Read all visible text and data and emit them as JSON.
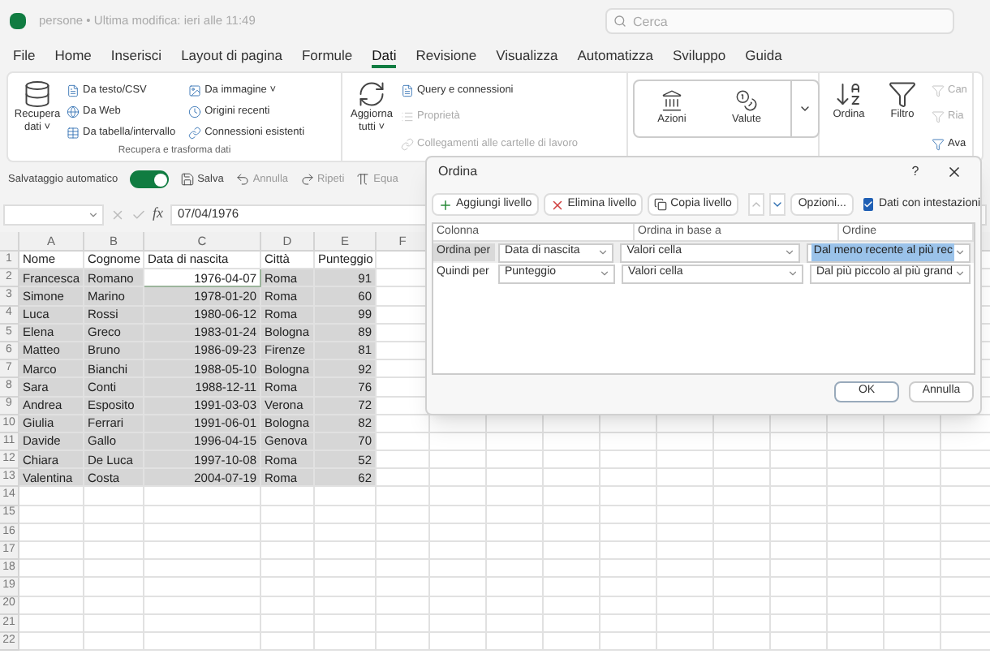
{
  "title_bar": {
    "file_title": "persone • Ultima modifica: ieri alle 11:49",
    "search": {
      "placeholder": "Cerca"
    }
  },
  "menu_tabs": [
    {
      "label": "File",
      "selected": false
    },
    {
      "label": "Home",
      "selected": false
    },
    {
      "label": "Inserisci",
      "selected": false
    },
    {
      "label": "Layout di pagina",
      "selected": false
    },
    {
      "label": "Formule",
      "selected": false
    },
    {
      "label": "Dati",
      "selected": true
    },
    {
      "label": "Revisione",
      "selected": false
    },
    {
      "label": "Visualizza",
      "selected": false
    },
    {
      "label": "Automatizza",
      "selected": false
    },
    {
      "label": "Sviluppo",
      "selected": false
    },
    {
      "label": "Guida",
      "selected": false
    }
  ],
  "ribbon": {
    "groups": [
      {
        "label": "Recupera e trasforma dati",
        "big": [
          {
            "label": "Recupera dati ˅"
          }
        ],
        "small": [
          {
            "label": "Da testo/CSV",
            "disabled": false
          },
          {
            "label": "Da Web",
            "disabled": false
          },
          {
            "label": "Da tabella/intervallo",
            "disabled": false
          },
          {
            "label": "Da immagine ˅",
            "disabled": false
          },
          {
            "label": "Origini recenti",
            "disabled": false
          },
          {
            "label": "Connessioni esistenti",
            "disabled": false
          }
        ]
      },
      {
        "big": [
          {
            "label": "Aggiorna tutti ˅"
          }
        ],
        "small": [
          {
            "label": "Query e connessioni",
            "disabled": false
          },
          {
            "label": "Proprietà",
            "disabled": true
          },
          {
            "label": "Collegamenti alle cartelle di lavoro",
            "disabled": true
          }
        ]
      },
      {
        "gallery": [
          {
            "label": "Azioni"
          },
          {
            "label": "Valute"
          }
        ]
      },
      {
        "big": [
          {
            "label": "Ordina"
          },
          {
            "label": "Filtro"
          }
        ],
        "small": [
          {
            "label": "Can",
            "disabled": true
          },
          {
            "label": "Ria",
            "disabled": true
          },
          {
            "label": "Ava",
            "disabled": false
          }
        ]
      }
    ]
  },
  "quick_access": {
    "autosave_label": "Salvataggio automatico",
    "autosave_on": true,
    "items": [
      {
        "label": "Salva"
      },
      {
        "label": "Annulla"
      },
      {
        "label": "Ripeti"
      },
      {
        "label": "Equa"
      }
    ]
  },
  "formula_bar": {
    "function_label": "fx",
    "formula": "07/04/1976"
  },
  "sheet": {
    "columns": [
      "A",
      "B",
      "C",
      "D",
      "E",
      "F"
    ],
    "rows": [
      {
        "number": "1",
        "kind": "header",
        "selected": false,
        "cells": [
          {
            "text": "Nome",
            "active": false
          },
          {
            "text": "Cognome",
            "active": false
          },
          {
            "text": "Data di nascita",
            "active": false
          },
          {
            "text": "Città",
            "active": false
          },
          {
            "text": "Punteggio",
            "active": false
          }
        ]
      },
      {
        "number": "2",
        "kind": "data",
        "selected": true,
        "cells": [
          {
            "text": "Francesca",
            "active": false
          },
          {
            "text": "Romano",
            "active": false
          },
          {
            "text": "1976-04-07",
            "active": true
          },
          {
            "text": "Roma",
            "active": false
          },
          {
            "text": "91",
            "active": false
          }
        ]
      },
      {
        "number": "3",
        "kind": "data",
        "selected": true,
        "cells": [
          {
            "text": "Simone",
            "active": false
          },
          {
            "text": "Marino",
            "active": false
          },
          {
            "text": "1978-01-20",
            "active": false
          },
          {
            "text": "Roma",
            "active": false
          },
          {
            "text": "60",
            "active": false
          }
        ]
      },
      {
        "number": "4",
        "kind": "data",
        "selected": true,
        "cells": [
          {
            "text": "Luca",
            "active": false
          },
          {
            "text": "Rossi",
            "active": false
          },
          {
            "text": "1980-06-12",
            "active": false
          },
          {
            "text": "Roma",
            "active": false
          },
          {
            "text": "99",
            "active": false
          }
        ]
      },
      {
        "number": "5",
        "kind": "data",
        "selected": true,
        "cells": [
          {
            "text": "Elena",
            "active": false
          },
          {
            "text": "Greco",
            "active": false
          },
          {
            "text": "1983-01-24",
            "active": false
          },
          {
            "text": "Bologna",
            "active": false
          },
          {
            "text": "89",
            "active": false
          }
        ]
      },
      {
        "number": "6",
        "kind": "data",
        "selected": true,
        "cells": [
          {
            "text": "Matteo",
            "active": false
          },
          {
            "text": "Bruno",
            "active": false
          },
          {
            "text": "1986-09-23",
            "active": false
          },
          {
            "text": "Firenze",
            "active": false
          },
          {
            "text": "81",
            "active": false
          }
        ]
      },
      {
        "number": "7",
        "kind": "data",
        "selected": true,
        "cells": [
          {
            "text": "Marco",
            "active": false
          },
          {
            "text": "Bianchi",
            "active": false
          },
          {
            "text": "1988-05-10",
            "active": false
          },
          {
            "text": "Bologna",
            "active": false
          },
          {
            "text": "92",
            "active": false
          }
        ]
      },
      {
        "number": "8",
        "kind": "data",
        "selected": true,
        "cells": [
          {
            "text": "Sara",
            "active": false
          },
          {
            "text": "Conti",
            "active": false
          },
          {
            "text": "1988-12-11",
            "active": false
          },
          {
            "text": "Roma",
            "active": false
          },
          {
            "text": "76",
            "active": false
          }
        ]
      },
      {
        "number": "9",
        "kind": "data",
        "selected": true,
        "cells": [
          {
            "text": "Andrea",
            "active": false
          },
          {
            "text": "Esposito",
            "active": false
          },
          {
            "text": "1991-03-03",
            "active": false
          },
          {
            "text": "Verona",
            "active": false
          },
          {
            "text": "72",
            "active": false
          }
        ]
      },
      {
        "number": "10",
        "kind": "data",
        "selected": true,
        "cells": [
          {
            "text": "Giulia",
            "active": false
          },
          {
            "text": "Ferrari",
            "active": false
          },
          {
            "text": "1991-06-01",
            "active": false
          },
          {
            "text": "Bologna",
            "active": false
          },
          {
            "text": "82",
            "active": false
          }
        ]
      },
      {
        "number": "11",
        "kind": "data",
        "selected": true,
        "cells": [
          {
            "text": "Davide",
            "active": false
          },
          {
            "text": "Gallo",
            "active": false
          },
          {
            "text": "1996-04-15",
            "active": false
          },
          {
            "text": "Genova",
            "active": false
          },
          {
            "text": "70",
            "active": false
          }
        ]
      },
      {
        "number": "12",
        "kind": "data",
        "selected": true,
        "cells": [
          {
            "text": "Chiara",
            "active": false
          },
          {
            "text": "De Luca",
            "active": false
          },
          {
            "text": "1997-10-08",
            "active": false
          },
          {
            "text": "Roma",
            "active": false
          },
          {
            "text": "52",
            "active": false
          }
        ]
      },
      {
        "number": "13",
        "kind": "data",
        "selected": true,
        "cells": [
          {
            "text": "Valentina",
            "active": false
          },
          {
            "text": "Costa",
            "active": false
          },
          {
            "text": "2004-07-19",
            "active": false
          },
          {
            "text": "Roma",
            "active": false
          },
          {
            "text": "62",
            "active": false
          }
        ]
      },
      {
        "number": "14"
      },
      {
        "number": "15"
      },
      {
        "number": "16"
      },
      {
        "number": "17"
      },
      {
        "number": "18"
      },
      {
        "number": "19"
      },
      {
        "number": "20"
      },
      {
        "number": "21"
      },
      {
        "number": "22"
      }
    ]
  },
  "sort_dialog": {
    "title": "Ordina",
    "help": "?",
    "toolbar": [
      {
        "label": "Aggiungi livello"
      },
      {
        "label": "Elimina livello"
      },
      {
        "label": "Copia livello"
      },
      {
        "label": "Opzioni..."
      }
    ],
    "headers_checkbox": {
      "label": "Dati con intestazioni",
      "checked": true
    },
    "columns": [
      "Colonna",
      "Ordina in base a",
      "Ordine"
    ],
    "levels": [
      {
        "label": "Ordina per",
        "column": "Data di nascita",
        "sort_on": "Valori cella",
        "order": "Dal meno recente al più rec",
        "selected": true
      },
      {
        "label": "Quindi per",
        "column": "Punteggio",
        "sort_on": "Valori cella",
        "order": "Dal più piccolo al più grand",
        "selected": false
      }
    ],
    "buttons": [
      "OK",
      "Annulla"
    ]
  }
}
